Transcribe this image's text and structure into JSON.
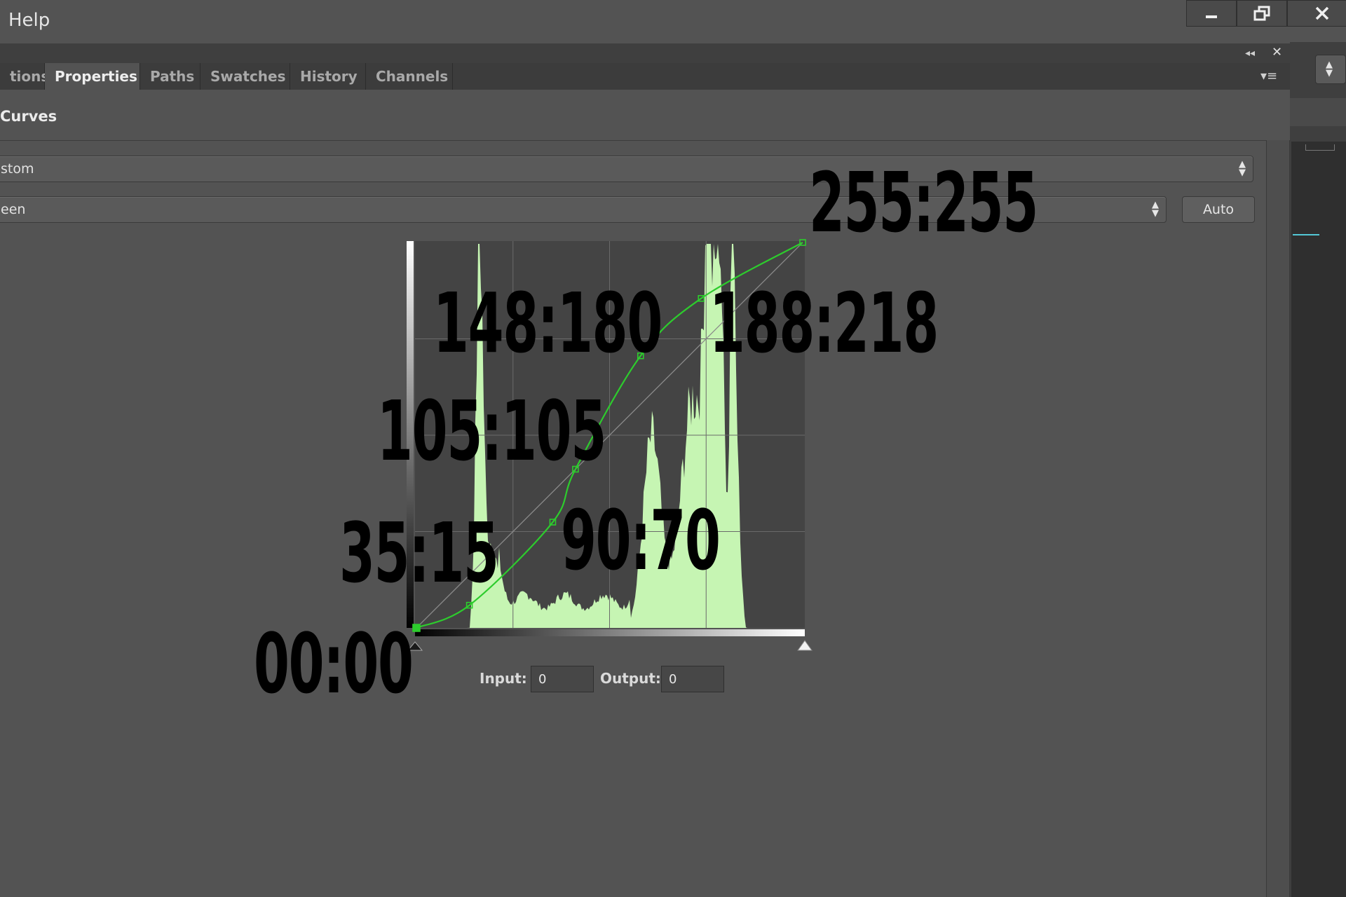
{
  "menubar": {
    "help_label": "Help"
  },
  "window_controls": {
    "minimize_icon": "minimize-icon",
    "restore_icon": "restore-icon",
    "close_icon": "close-icon"
  },
  "tabs": [
    {
      "label": "tions",
      "active": false
    },
    {
      "label": "Properties",
      "active": true
    },
    {
      "label": "Paths",
      "active": false
    },
    {
      "label": "Swatches",
      "active": false
    },
    {
      "label": "History",
      "active": false
    },
    {
      "label": "Channels",
      "active": false
    }
  ],
  "properties": {
    "title": "Curves",
    "preset_value": "stom",
    "channel_value": "een",
    "auto_label": "Auto",
    "input_label": "Input:",
    "input_value": "0",
    "output_label": "Output:",
    "output_value": "0"
  },
  "curve": {
    "color": "#2dcc2d",
    "histogram_color": "#c6f5b3",
    "range": [
      0,
      255
    ],
    "points": [
      {
        "input": 0,
        "output": 0,
        "label": "00:00"
      },
      {
        "input": 35,
        "output": 15,
        "label": "35:15"
      },
      {
        "input": 90,
        "output": 70,
        "label": "90:70"
      },
      {
        "input": 105,
        "output": 105,
        "label": "105:105"
      },
      {
        "input": 148,
        "output": 180,
        "label": "148:180"
      },
      {
        "input": 188,
        "output": 218,
        "label": "188:218"
      },
      {
        "input": 255,
        "output": 255,
        "label": "255:255"
      }
    ]
  },
  "annotation_color": "#000000"
}
